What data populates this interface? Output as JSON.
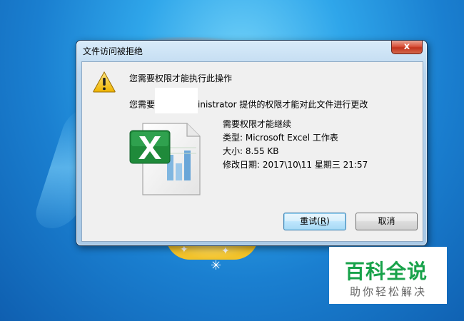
{
  "dialog": {
    "title": "文件访问被拒绝",
    "close_symbol": "x",
    "main_instruction": "您需要权限才能执行此操作",
    "message_prefix": "您需要",
    "message_suffix": "inistrator 提供的权限才能对此文件进行更改",
    "details": [
      "需要权限才能继续",
      "类型: Microsoft Excel 工作表",
      "大小: 8.55 KB",
      "修改日期: 2017\\10\\11 星期三 21:57"
    ],
    "buttons": {
      "retry_label": "重试(",
      "retry_mnemonic": "R",
      "retry_close": ")",
      "cancel_label": "取消"
    },
    "icons": {
      "warning": "warning-icon",
      "file": "excel-file-icon"
    }
  },
  "watermark": {
    "title": "百科全说",
    "subtitle": "助你轻松解决"
  },
  "colors": {
    "desktop": "#1a7fd0",
    "close_button": "#c2331c",
    "watermark_green": "#18a24a"
  }
}
